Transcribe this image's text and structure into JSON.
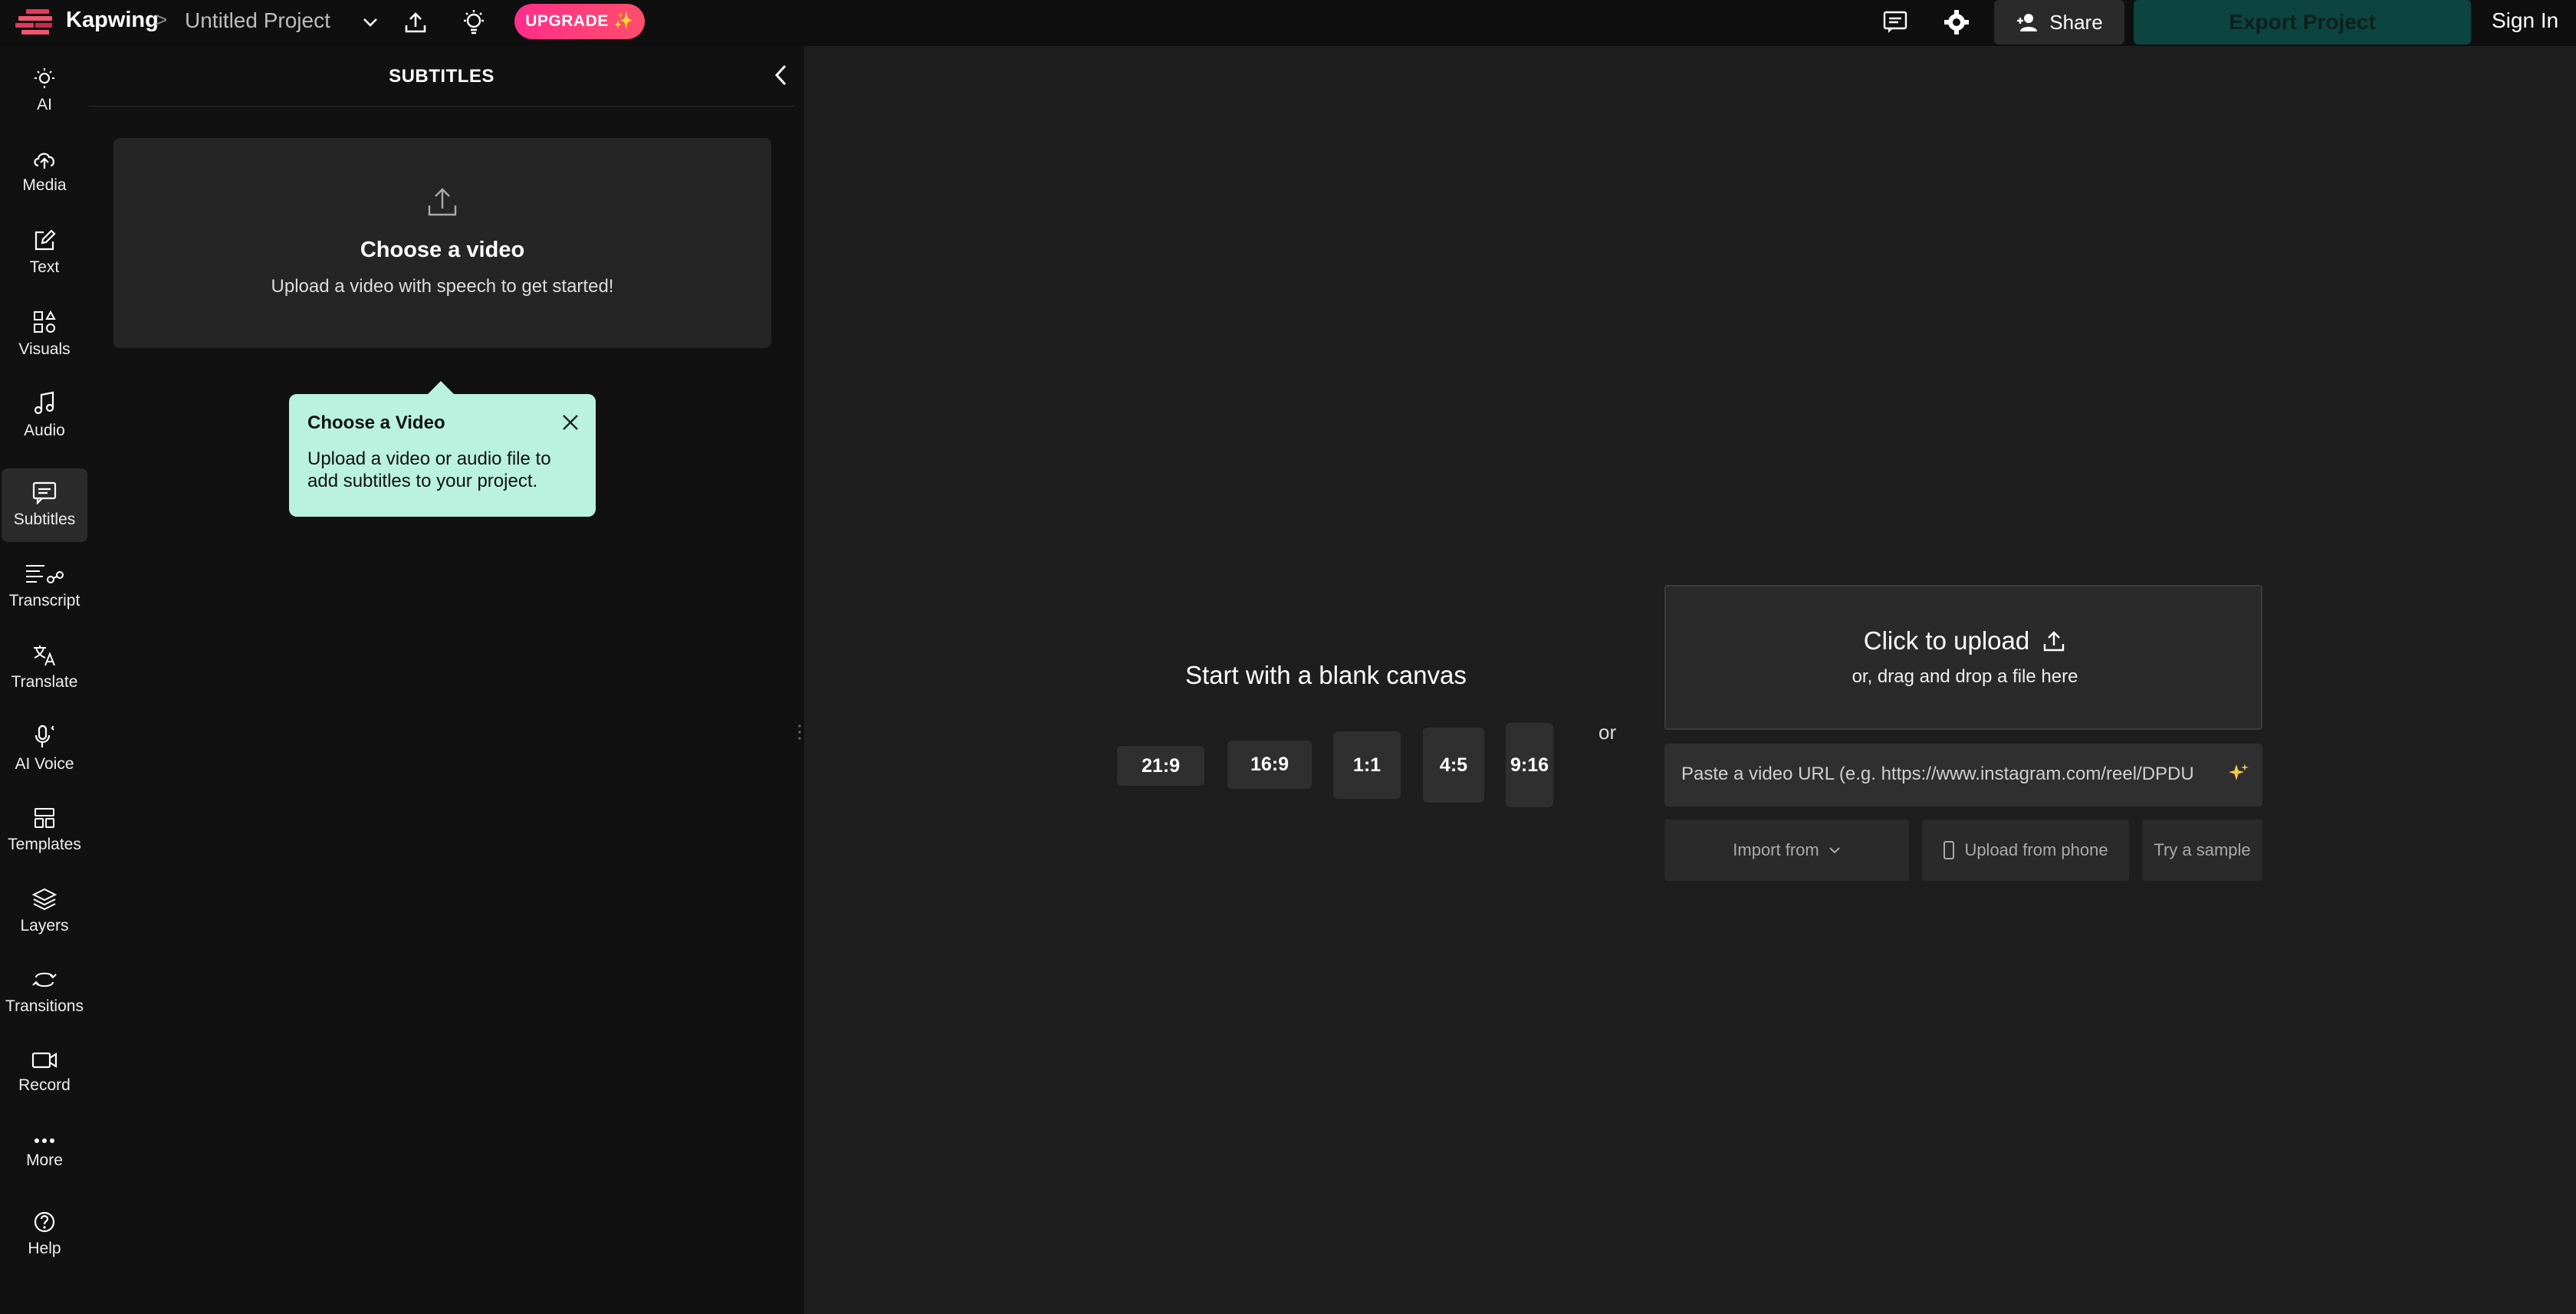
{
  "header": {
    "brand": "Kapwing",
    "breadcrumb_sep": ">",
    "project_title": "Untitled Project",
    "upgrade_label": "UPGRADE ✨",
    "share_label": "Share",
    "export_label": "Export Project",
    "signin_label": "Sign In",
    "colors": {
      "upgrade": "#ff2d8a",
      "export": "#0c4540",
      "accent_tooltip": "#b9f2df"
    }
  },
  "rail": {
    "items": [
      {
        "label": "AI",
        "icon": "bulb-icon"
      },
      {
        "label": "Media",
        "icon": "cloud-upload-icon"
      },
      {
        "label": "Text",
        "icon": "edit-icon"
      },
      {
        "label": "Visuals",
        "icon": "shapes-icon"
      },
      {
        "label": "Audio",
        "icon": "music-icon"
      },
      {
        "label": "Subtitles",
        "icon": "subtitles-icon"
      },
      {
        "label": "Transcript",
        "icon": "transcript-icon"
      },
      {
        "label": "Translate",
        "icon": "translate-icon"
      },
      {
        "label": "AI Voice",
        "icon": "mic-icon"
      },
      {
        "label": "Templates",
        "icon": "templates-icon"
      },
      {
        "label": "Layers",
        "icon": "layers-icon"
      },
      {
        "label": "Transitions",
        "icon": "transitions-icon"
      },
      {
        "label": "Record",
        "icon": "record-icon"
      },
      {
        "label": "More",
        "icon": "more-icon"
      },
      {
        "label": "Help",
        "icon": "help-icon"
      }
    ],
    "active": "Subtitles"
  },
  "panel": {
    "title": "SUBTITLES",
    "choose_title": "Choose a video",
    "choose_sub": "Upload a video with speech to get started!",
    "tooltip_title": "Choose a Video",
    "tooltip_body": "Upload a video or audio file to add subtitles to your project."
  },
  "canvas": {
    "blank_title": "Start with a blank canvas",
    "ratios": [
      "21:9",
      "16:9",
      "1:1",
      "4:5",
      "9:16"
    ],
    "or_label": "or",
    "upload_title": "Click to upload",
    "upload_sub": "or, drag and drop a file here",
    "url_placeholder": "Paste a video URL (e.g. https://www.instagram.com/reel/DPDU",
    "import_label": "Import from",
    "phone_label": "Upload from phone",
    "sample_label": "Try a sample"
  }
}
